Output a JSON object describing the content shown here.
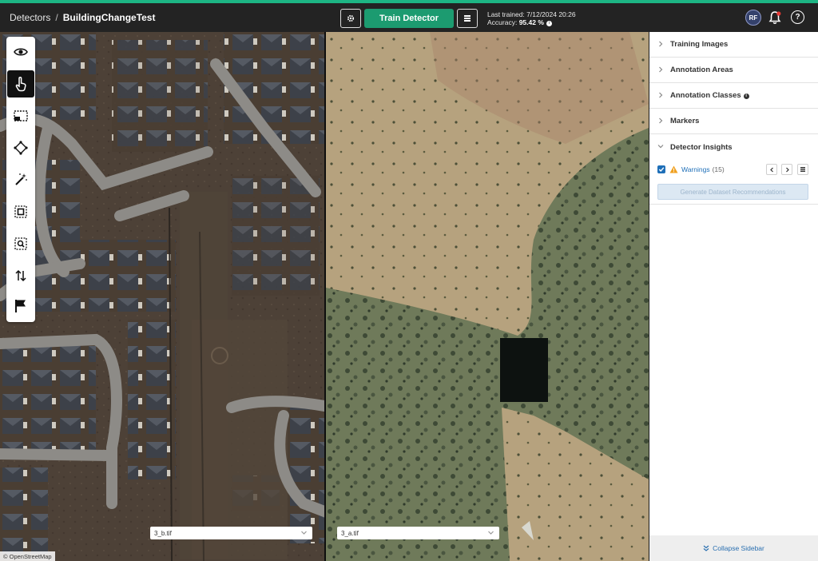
{
  "header": {
    "breadcrumb_root": "Detectors",
    "breadcrumb_sep": "/",
    "breadcrumb_current": "BuildingChangeTest",
    "settings_icon": "gear-icon",
    "train_label": "Train Detector",
    "queue_icon": "list-icon",
    "last_trained_label": "Last trained:",
    "last_trained_value": "7/12/2024 20:26",
    "accuracy_label": "Accuracy:",
    "accuracy_value": "95.42 %",
    "avatar_initials": "RF",
    "bell_icon": "bell-icon",
    "help_glyph": "?",
    "accent_color": "#1db584"
  },
  "toolbar": {
    "tools": [
      {
        "name": "view",
        "icon": "eye-icon",
        "active": false
      },
      {
        "name": "select",
        "icon": "hand-pointer-icon",
        "active": true
      },
      {
        "name": "rectangle",
        "icon": "rectangle-select-icon",
        "active": false
      },
      {
        "name": "polygon",
        "icon": "polygon-icon",
        "active": false
      },
      {
        "name": "magic",
        "icon": "magic-wand-icon",
        "active": false
      },
      {
        "name": "area",
        "icon": "area-select-icon",
        "active": false
      },
      {
        "name": "zoom-area",
        "icon": "zoom-area-icon",
        "active": false
      },
      {
        "name": "swap",
        "icon": "swap-vertical-icon",
        "active": false
      },
      {
        "name": "marker",
        "icon": "flag-icon",
        "active": false
      }
    ]
  },
  "maps": {
    "left_file": "3_b.tif",
    "right_file": "3_a.tif",
    "attribution": "© OpenStreetMap"
  },
  "sidebar": {
    "sections": [
      {
        "label": "Training Images",
        "expanded": false,
        "info": false
      },
      {
        "label": "Annotation Areas",
        "expanded": false,
        "info": false
      },
      {
        "label": "Annotation Classes",
        "expanded": false,
        "info": true
      },
      {
        "label": "Markers",
        "expanded": false,
        "info": false
      },
      {
        "label": "Detector Insights",
        "expanded": true,
        "info": false
      }
    ],
    "warnings_label": "Warnings",
    "warnings_count": "(15)",
    "warnings_checked": true,
    "generate_label": "Generate Dataset Recommendations",
    "collapse_label": "Collapse Sidebar"
  }
}
